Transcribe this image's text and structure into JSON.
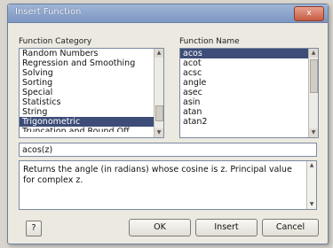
{
  "title": "Insert Function",
  "close_symbol": "x",
  "category": {
    "label": "Function Category",
    "items": [
      "Random Numbers",
      "Regression and Smoothing",
      "Solving",
      "Sorting",
      "Special",
      "Statistics",
      "String",
      "Trigonometric",
      "Truncation and Round Off"
    ],
    "selected": "Trigonometric"
  },
  "function_name": {
    "label": "Function Name",
    "items": [
      "acos",
      "acot",
      "acsc",
      "angle",
      "asec",
      "asin",
      "atan",
      "atan2"
    ],
    "selected": "acos"
  },
  "signature": "acos(z)",
  "description": "Returns the angle (in radians) whose cosine is z. Principal value for complex z.",
  "buttons": {
    "help": "?",
    "ok": "OK",
    "insert": "Insert",
    "cancel": "Cancel"
  }
}
